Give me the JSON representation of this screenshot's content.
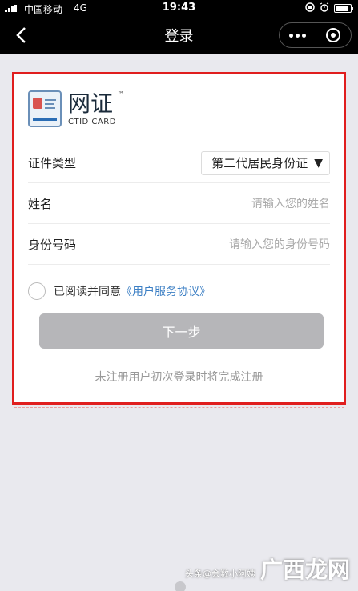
{
  "status_bar": {
    "carrier": "中国移动",
    "network": "4G",
    "time": "19:43"
  },
  "nav": {
    "title": "登录"
  },
  "brand": {
    "name": "网证",
    "trademark": "™",
    "subtitle": "CTID CARD"
  },
  "form": {
    "id_type_label": "证件类型",
    "id_type_value": "第二代居民身份证",
    "name_label": "姓名",
    "name_placeholder": "请输入您的姓名",
    "id_number_label": "身份号码",
    "id_number_placeholder": "请输入您的身份号码",
    "agree_text": "已阅读并同意",
    "agree_link": "《用户服务协议》",
    "next_button": "下一步",
    "hint": "未注册用户初次登录时将完成注册"
  },
  "watermark": {
    "small": "头条@会数小阿姨",
    "big": "广西龙网"
  },
  "colors": {
    "highlight_border": "#e01e1e",
    "link": "#3c7fc4",
    "button_disabled": "#b6b6b9"
  }
}
